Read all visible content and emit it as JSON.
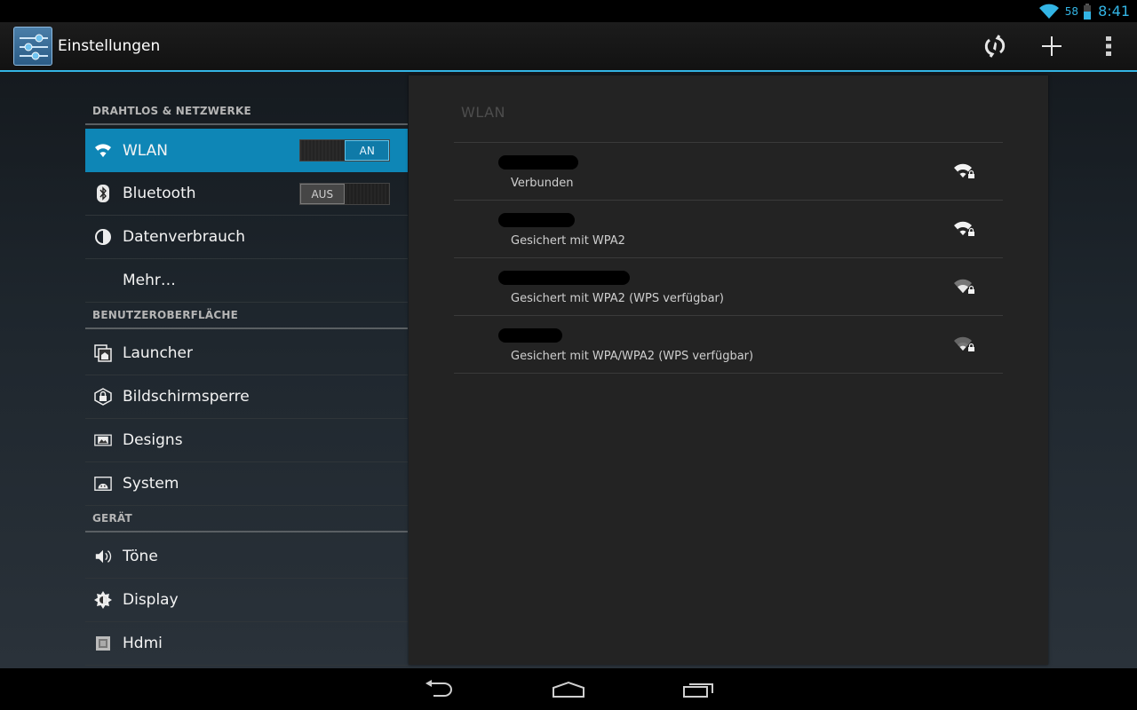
{
  "status_bar": {
    "battery_percent": "58",
    "time": "8:41",
    "accent_color": "#33b5e5"
  },
  "action_bar": {
    "title": "Einstellungen",
    "icons": [
      "settings-sliders-icon",
      "wps-icon",
      "add-icon",
      "overflow-menu-icon"
    ]
  },
  "sections": [
    {
      "header": "DRAHTLOS & NETZWERKE",
      "items": [
        {
          "label": "WLAN",
          "icon": "wifi-icon",
          "toggle": {
            "off": "",
            "on": "AN",
            "state": "on"
          },
          "active": true
        },
        {
          "label": "Bluetooth",
          "icon": "bluetooth-icon",
          "toggle": {
            "off": "AUS",
            "on": "",
            "state": "off"
          }
        },
        {
          "label": "Datenverbrauch",
          "icon": "data-usage-icon"
        },
        {
          "label": "Mehr…",
          "icon": ""
        }
      ]
    },
    {
      "header": "BENUTZEROBERFLÄCHE",
      "items": [
        {
          "label": "Launcher",
          "icon": "launcher-icon"
        },
        {
          "label": "Bildschirmsperre",
          "icon": "lock-icon"
        },
        {
          "label": "Designs",
          "icon": "designs-icon"
        },
        {
          "label": "System",
          "icon": "system-icon"
        }
      ]
    },
    {
      "header": "GERÄT",
      "items": [
        {
          "label": "Töne",
          "icon": "speaker-icon"
        },
        {
          "label": "Display",
          "icon": "brightness-icon"
        },
        {
          "label": "Hdmi",
          "icon": "hdmi-icon"
        }
      ]
    }
  ],
  "wifi_panel": {
    "title": "WLAN",
    "networks": [
      {
        "status": "Verbunden",
        "signal": "strong"
      },
      {
        "status": "Gesichert mit WPA2",
        "signal": "strong"
      },
      {
        "status": "Gesichert mit WPA2 (WPS verfügbar)",
        "signal": "medium"
      },
      {
        "status": "Gesichert mit WPA/WPA2 (WPS verfügbar)",
        "signal": "medium"
      }
    ]
  },
  "nav_bar": {
    "icons": [
      "back-icon",
      "home-icon",
      "recent-apps-icon"
    ]
  }
}
